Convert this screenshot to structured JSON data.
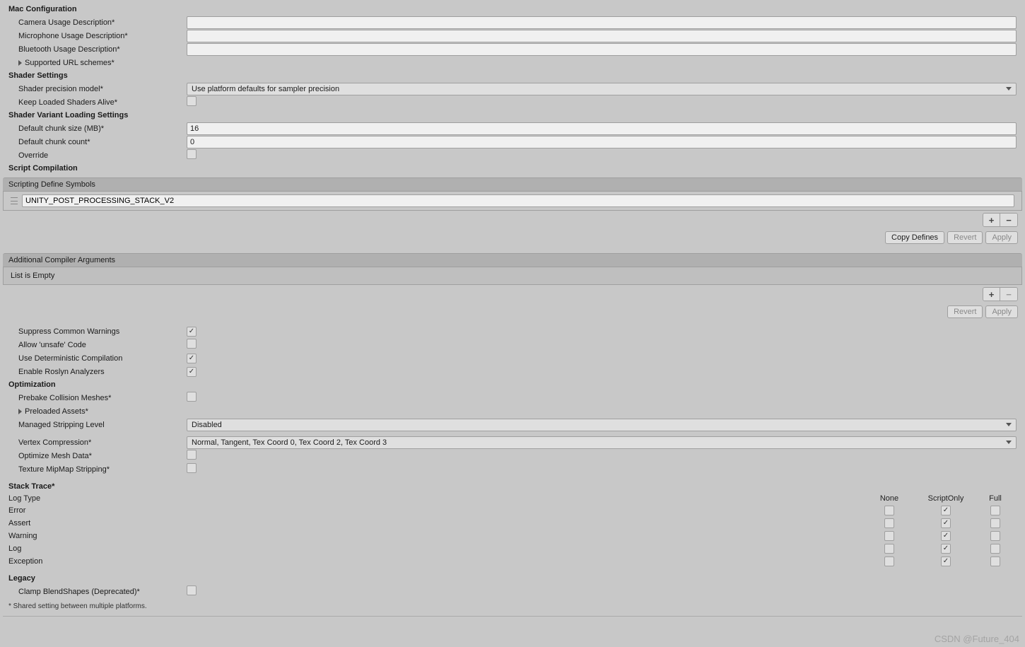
{
  "mac": {
    "header": "Mac Configuration",
    "camera": "Camera Usage Description*",
    "camera_val": "",
    "mic": "Microphone Usage Description*",
    "mic_val": "",
    "bluetooth": "Bluetooth Usage Description*",
    "bluetooth_val": "",
    "schemes": "Supported URL schemes*"
  },
  "shader": {
    "header": "Shader Settings",
    "precision": "Shader precision model*",
    "precision_val": "Use platform defaults for sampler precision",
    "keep_alive": "Keep Loaded Shaders Alive*"
  },
  "variant": {
    "header": "Shader Variant Loading Settings",
    "chunk_size": "Default chunk size (MB)*",
    "chunk_size_val": "16",
    "chunk_count": "Default chunk count*",
    "chunk_count_val": "0",
    "override": "Override"
  },
  "script": {
    "header": "Script Compilation",
    "defines_label": "Scripting Define Symbols",
    "define0": "UNITY_POST_PROCESSING_STACK_V2",
    "copy_defines": "Copy Defines",
    "revert": "Revert",
    "apply": "Apply",
    "additional_args": "Additional Compiler Arguments",
    "empty": "List is Empty",
    "suppress_warn": "Suppress Common Warnings",
    "allow_unsafe": "Allow 'unsafe' Code",
    "deterministic": "Use Deterministic Compilation",
    "roslyn": "Enable Roslyn Analyzers"
  },
  "opt": {
    "header": "Optimization",
    "prebake": "Prebake Collision Meshes*",
    "preloaded": "Preloaded Assets*",
    "strip": "Managed Stripping Level",
    "strip_val": "Disabled",
    "vertex": "Vertex Compression*",
    "vertex_val": "Normal, Tangent, Tex Coord 0, Tex Coord 2, Tex Coord 3",
    "optmesh": "Optimize Mesh Data*",
    "mipmap": "Texture MipMap Stripping*"
  },
  "stack": {
    "header": "Stack Trace*",
    "logtype": "Log Type",
    "none": "None",
    "scriptonly": "ScriptOnly",
    "full": "Full",
    "rows": [
      "Error",
      "Assert",
      "Warning",
      "Log",
      "Exception"
    ]
  },
  "legacy": {
    "header": "Legacy",
    "clamp": "Clamp BlendShapes (Deprecated)*"
  },
  "footnote": "* Shared setting between multiple platforms.",
  "watermark": "CSDN @Future_404"
}
